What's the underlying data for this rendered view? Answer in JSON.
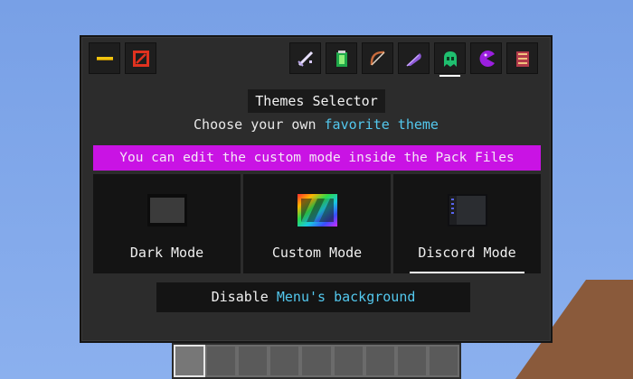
{
  "title": "Themes Selector",
  "subtitle": {
    "prefix": "Choose your own",
    "highlight": "favorite theme"
  },
  "notice": "You can edit the custom mode inside the Pack Files",
  "modes": [
    {
      "label": "Dark Mode"
    },
    {
      "label": "Custom Mode"
    },
    {
      "label": "Discord Mode",
      "selected": true
    }
  ],
  "disable": {
    "prefix": "Disable",
    "highlight": "Menu's background"
  },
  "toolbar_left": [
    "minus-icon",
    "cancel-icon"
  ],
  "toolbar_right": [
    "sword-icon",
    "potion-icon",
    "bow-icon",
    "feather-icon",
    "ghost-icon",
    "pacman-icon",
    "book-icon"
  ],
  "active_tab": "ghost-icon",
  "hotbar_slots": 9,
  "hotbar_selected": 1,
  "colors": {
    "accent": "#c913e4",
    "highlight": "#53c8ee",
    "panel": "#2c2c2c"
  }
}
